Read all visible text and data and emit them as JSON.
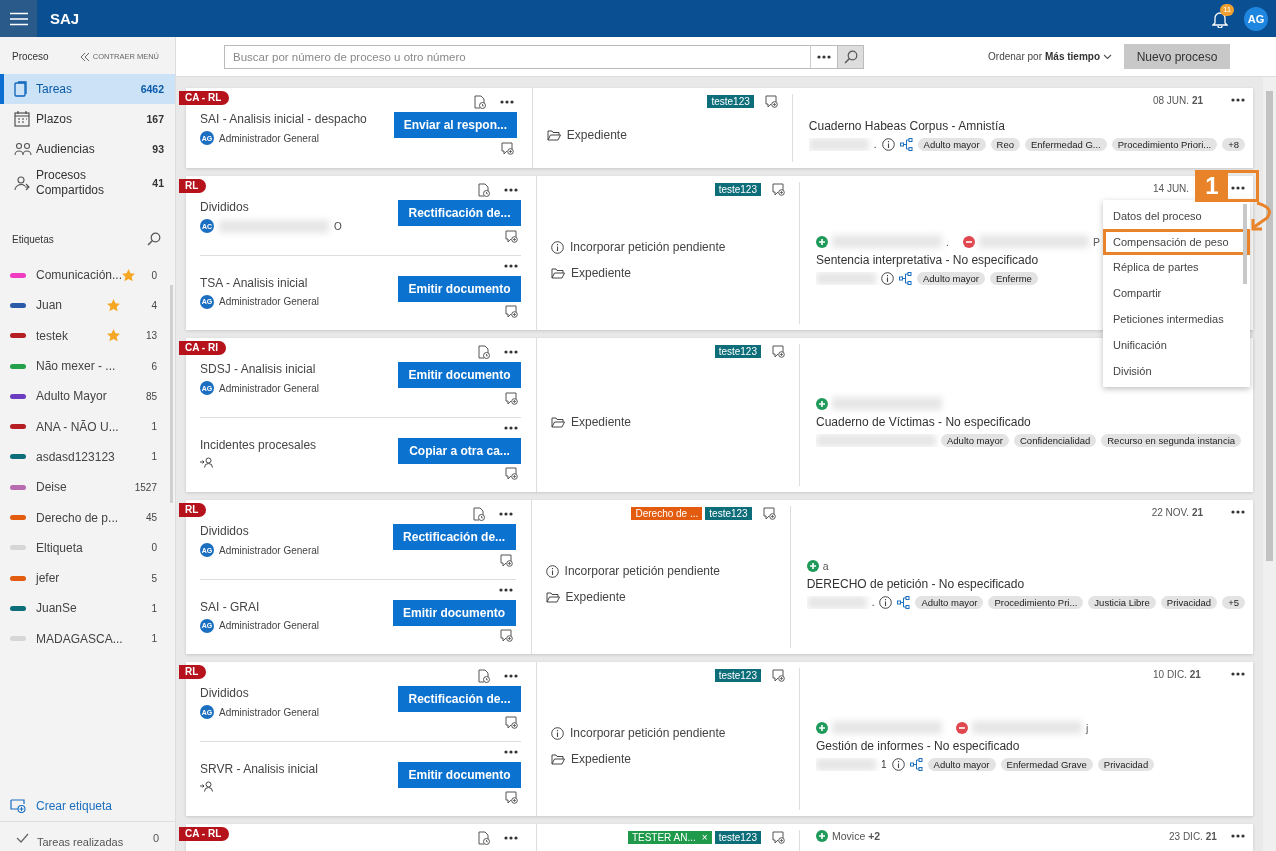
{
  "topbar": {
    "title": "SAJ",
    "notifications": "11",
    "user_initials": "AG"
  },
  "sidebar": {
    "heading": "Proceso",
    "collapse": "CONTRAER MENÚ",
    "nav": [
      {
        "kind": "tasks",
        "label": "Tareas",
        "count": "6462",
        "selected": true
      },
      {
        "kind": "deadlines",
        "label": "Plazos",
        "count": "167",
        "selected": false
      },
      {
        "kind": "hearings",
        "label": "Audiencias",
        "count": "93",
        "selected": false
      },
      {
        "kind": "shared",
        "label": "Procesos Compartidos",
        "count": "41",
        "selected": false
      }
    ],
    "labels_heading": "Etiquetas",
    "labels": [
      {
        "name": "Comunicación...",
        "color": "#f03cc0",
        "starred": true,
        "count": "0"
      },
      {
        "name": "Juan",
        "color": "#2b5aa8",
        "starred": true,
        "count": "4"
      },
      {
        "name": "testek",
        "color": "#b51e23",
        "starred": true,
        "count": "13"
      },
      {
        "name": "Não mexer - ...",
        "color": "#22a04a",
        "starred": false,
        "count": "6"
      },
      {
        "name": "Adulto Mayor",
        "color": "#6b3cc0",
        "starred": false,
        "count": "85"
      },
      {
        "name": "ANA - NÃO U...",
        "color": "#b51e23",
        "starred": false,
        "count": "1"
      },
      {
        "name": "asdasd123123",
        "color": "#0d6e7a",
        "starred": false,
        "count": "1"
      },
      {
        "name": "Deise",
        "color": "#b86bb0",
        "starred": false,
        "count": "1527"
      },
      {
        "name": "Derecho de p...",
        "color": "#e35b0f",
        "starred": false,
        "count": "45"
      },
      {
        "name": "Eltiqueta",
        "color": "#d6d6d6",
        "starred": false,
        "count": "0"
      },
      {
        "name": "jefer",
        "color": "#e35b0f",
        "starred": false,
        "count": "5"
      },
      {
        "name": "JuanSe",
        "color": "#0d6e7a",
        "starred": false,
        "count": "1"
      },
      {
        "name": "MADAGASCA...",
        "color": "#d6d6d6",
        "starred": false,
        "count": "1"
      }
    ],
    "create_label": "Crear etiqueta",
    "done": {
      "label": "Tareas realizadas",
      "count": "0"
    }
  },
  "toolbar": {
    "search": {
      "placeholder": "Buscar por número de proceso u otro número"
    },
    "sort_label": "Ordenar por",
    "sort_value": "Más tiempo",
    "new_button": "Nuevo proceso"
  },
  "cards": [
    {
      "badge": "CA - RL",
      "tasks": [
        {
          "title": "SAI - Analisis inicial - despacho",
          "initials": "AG",
          "assignee": "Administrador General",
          "action": "Enviar al respon..."
        }
      ],
      "tags": [
        {
          "label": "teste123",
          "color": "#0d6e7a"
        }
      ],
      "notes": [
        {
          "kind": "folder",
          "text": "Expediente"
        }
      ],
      "date": "08 JUN. **21**",
      "subject": "Cuaderno Habeas Corpus - Amnistía",
      "case_number": ".",
      "info_icons": true,
      "chips": [
        "Adulto mayor",
        "Reo",
        "Enfermedad G...",
        "Procedimiento Priori...",
        "+8"
      ]
    },
    {
      "badge": "RL",
      "tasks": [
        {
          "title": "Divididos",
          "initials": "AC",
          "assignee": "O",
          "redacted": true,
          "action": "Rectificación de..."
        },
        {
          "title": "TSA - Analisis inicial",
          "initials": "AG",
          "assignee": "Administrador General",
          "action": "Emitir documento"
        }
      ],
      "tags": [
        {
          "label": "teste123",
          "color": "#0d6e7a"
        }
      ],
      "notes": [
        {
          "kind": "info",
          "text": "Incorporar petición pendiente"
        },
        {
          "kind": "folder",
          "text": "Expediente"
        }
      ],
      "date": "14 JUN.",
      "parties": [
        {
          "kind": "plus",
          "name": "."
        },
        {
          "kind": "minus",
          "name": "P"
        }
      ],
      "subject": "Sentencia interpretativa - No especificado",
      "info_icons": true,
      "chips": [
        "Adulto mayor",
        "Enferme"
      ]
    },
    {
      "badge": "CA - RI",
      "tasks": [
        {
          "title": "SDSJ - Analisis inicial",
          "initials": "AG",
          "assignee": "Administrador General",
          "action": "Emitir documento"
        },
        {
          "title": "Incidentes procesales",
          "action": "Copiar a otra ca..."
        }
      ],
      "tags": [
        {
          "label": "teste123",
          "color": "#0d6e7a"
        }
      ],
      "notes": [
        {
          "kind": "folder",
          "text": "Expediente"
        }
      ],
      "parties": [
        {
          "kind": "plus"
        }
      ],
      "subject": "Cuaderno de Víctimas - No especificado",
      "info_icons": false,
      "chips": [
        "Adulto mayor",
        "Confidencialidad",
        "Recurso en segunda instancia"
      ]
    },
    {
      "badge": "RL",
      "tasks": [
        {
          "title": "Divididos",
          "initials": "AG",
          "assignee": "Administrador General",
          "action": "Rectificación de..."
        },
        {
          "title": "SAI - GRAI",
          "initials": "AG",
          "assignee": "Administrador General",
          "action": "Emitir documento"
        }
      ],
      "tags": [
        {
          "label": "Derecho de ...",
          "color": "#e35b0f"
        },
        {
          "label": "teste123",
          "color": "#0d6e7a"
        }
      ],
      "notes": [
        {
          "kind": "info",
          "text": "Incorporar petición pendiente"
        },
        {
          "kind": "folder",
          "text": "Expediente"
        }
      ],
      "date": "22 NOV. **21**",
      "parties": [
        {
          "kind": "plus",
          "name": "a",
          "clear": true
        }
      ],
      "subject": "DERECHO de petición - No especificado",
      "case_number": ".",
      "info_icons": true,
      "chips": [
        "Adulto mayor",
        "Procedimiento Pri...",
        "Justicia Libre",
        "Privacidad",
        "+5"
      ]
    },
    {
      "badge": "RL",
      "tasks": [
        {
          "title": "Divididos",
          "initials": "AG",
          "assignee": "Administrador General",
          "action": "Rectificación de..."
        },
        {
          "title": "SRVR - Analisis inicial",
          "action": "Emitir documento"
        }
      ],
      "tags": [
        {
          "label": "teste123",
          "color": "#0d6e7a"
        }
      ],
      "notes": [
        {
          "kind": "info",
          "text": "Incorporar petición pendiente"
        },
        {
          "kind": "folder",
          "text": "Expediente"
        }
      ],
      "date": "10 DIC. **21**",
      "parties": [
        {
          "kind": "plus"
        },
        {
          "kind": "minus",
          "name": "j"
        }
      ],
      "subject": "Gestión de informes - No especificado",
      "case_number": "1",
      "info_icons": true,
      "chips": [
        "Adulto mayor",
        "Enfermedad Grave",
        "Privacidad"
      ]
    },
    {
      "badge": "CA - RL",
      "tags": [
        {
          "label": "TESTER AN...",
          "color": "#1f9a4a",
          "remove_label": "×"
        },
        {
          "label": "teste123",
          "color": "#0d6e7a"
        }
      ],
      "date": "23 DIC. **21**",
      "parties": [
        {
          "kind": "plus",
          "name": "Movice **+2**",
          "clear": true
        }
      ]
    }
  ],
  "context_menu": {
    "items": [
      {
        "label": "Datos del proceso",
        "highlighted": false
      },
      {
        "label": "Compensación de peso",
        "highlighted": true
      },
      {
        "label": "Réplica de partes",
        "highlighted": false
      },
      {
        "label": "Compartir",
        "highlighted": false
      },
      {
        "label": "Peticiones intermedias",
        "highlighted": false
      },
      {
        "label": "Unificación",
        "highlighted": false
      },
      {
        "label": "División",
        "highlighted": false
      }
    ]
  },
  "annotation": {
    "label": "1"
  }
}
